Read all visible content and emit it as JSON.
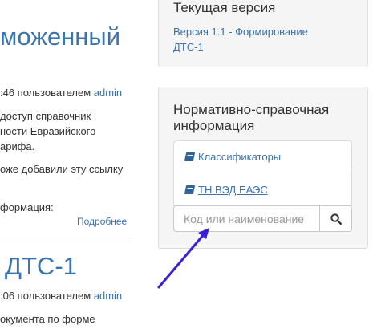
{
  "posts": [
    {
      "title": "моженный",
      "meta_prefix": ":46 пользователем ",
      "author": "admin",
      "lines": [
        "доступ справочник",
        "ности Евразийского",
        "арифа.",
        "оже добавили эту ссылку",
        "формация:"
      ],
      "more_label": "Подробнее"
    },
    {
      "title": "ДТС-1",
      "meta_prefix": ":06 пользователем ",
      "author": "admin",
      "lines": [
        "окумента по форме"
      ]
    }
  ],
  "sidebar": {
    "current_version": {
      "title": "Текущая версия",
      "link_lines": [
        "Версия 1.1 - Формирование",
        "ДТС-1"
      ]
    },
    "reference": {
      "title_lines": [
        "Нормативно-справочная",
        "информация"
      ],
      "items": [
        {
          "label": "Классификаторы",
          "icon": "book-icon"
        },
        {
          "label": "ТН ВЭД ЕАЭС",
          "icon": "book-icon"
        }
      ],
      "search": {
        "placeholder": "Код или наименование",
        "value": "",
        "button_icon": "search-icon"
      }
    }
  },
  "annotation": {
    "arrow_color": "#3a1fd6"
  },
  "colors": {
    "link": "#3b73ad",
    "panel_bg": "#f5f5f5"
  }
}
